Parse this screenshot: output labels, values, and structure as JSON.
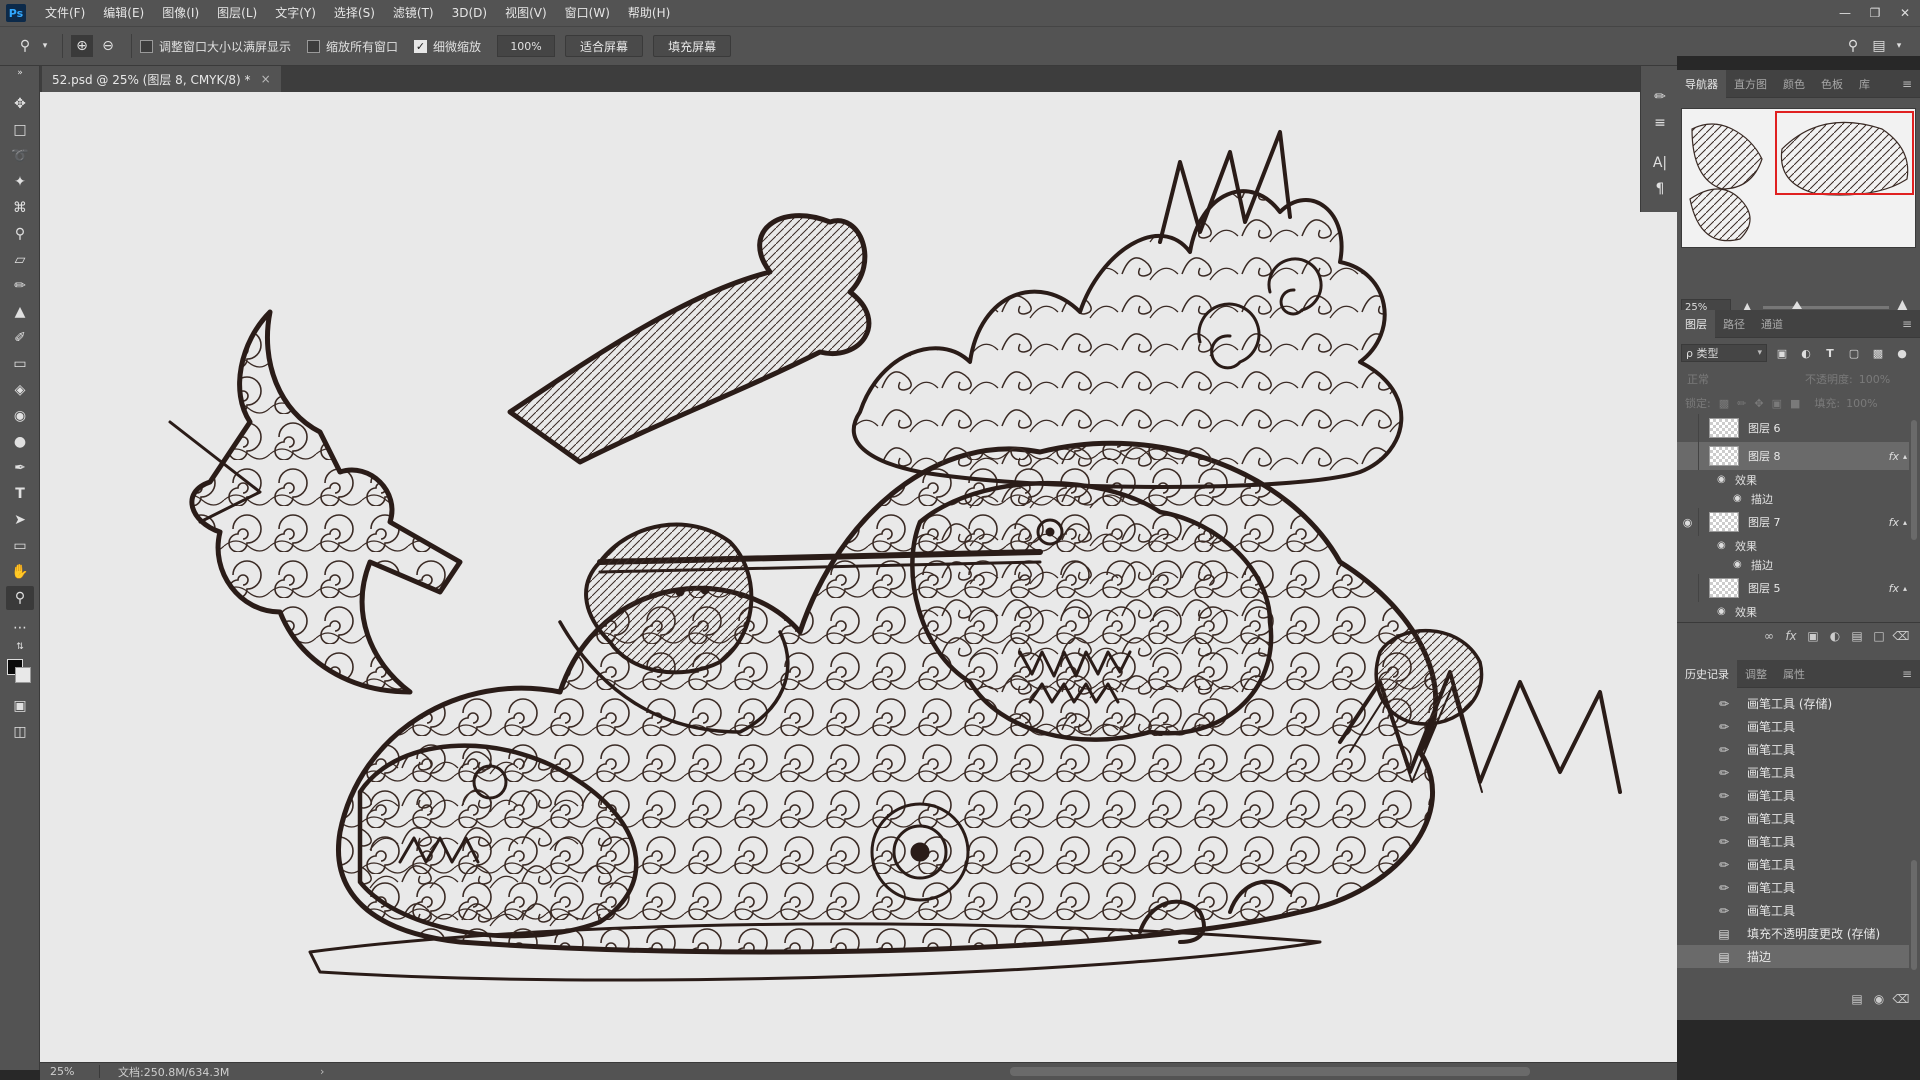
{
  "app": {
    "logo": "Ps"
  },
  "menu": [
    "文件(F)",
    "编辑(E)",
    "图像(I)",
    "图层(L)",
    "文字(Y)",
    "选择(S)",
    "滤镜(T)",
    "3D(D)",
    "视图(V)",
    "窗口(W)",
    "帮助(H)"
  ],
  "options": {
    "resize_windows_label": "调整窗口大小以满屏显示",
    "resize_windows_checked": false,
    "zoom_all_label": "缩放所有窗口",
    "zoom_all_checked": false,
    "scrubby_label": "细微缩放",
    "scrubby_checked": true,
    "zoom_value": "100%",
    "fit_screen_label": "适合屏幕",
    "fill_screen_label": "填充屏幕"
  },
  "document": {
    "tab_title": "52.psd @ 25% (图层 8, CMYK/8) *",
    "close_glyph": "×"
  },
  "status": {
    "zoom": "25%",
    "doc_info": "文档:250.8M/634.3M",
    "arrow": "›"
  },
  "navigator": {
    "tabs": [
      "导航器",
      "直方图",
      "颜色",
      "色板",
      "库"
    ],
    "zoom": "25%"
  },
  "layers": {
    "tabs": [
      "图层",
      "路径",
      "通道"
    ],
    "kind_label": "ρ 类型",
    "blend_mode": "正常",
    "opacity_label": "不透明度:",
    "opacity_value": "100%",
    "lock_label": "锁定:",
    "fill_label": "填充:",
    "fill_value": "100%",
    "items": [
      {
        "name": "图层 6",
        "visible": false,
        "fx": false,
        "selected": false
      },
      {
        "name": "图层 8",
        "visible": false,
        "fx": true,
        "selected": true
      },
      {
        "name": "图层 7",
        "visible": true,
        "fx": true,
        "selected": false
      },
      {
        "name": "图层 5",
        "visible": false,
        "fx": true,
        "selected": false
      }
    ],
    "effects_label": "效果",
    "stroke_label": "描边",
    "fx_label": "fx"
  },
  "history": {
    "tabs": [
      "历史记录",
      "调整",
      "属性"
    ],
    "items": [
      "画笔工具 (存储)",
      "画笔工具",
      "画笔工具",
      "画笔工具",
      "画笔工具",
      "画笔工具",
      "画笔工具",
      "画笔工具",
      "画笔工具",
      "画笔工具",
      "填充不透明度更改 (存储)",
      "描边"
    ]
  }
}
